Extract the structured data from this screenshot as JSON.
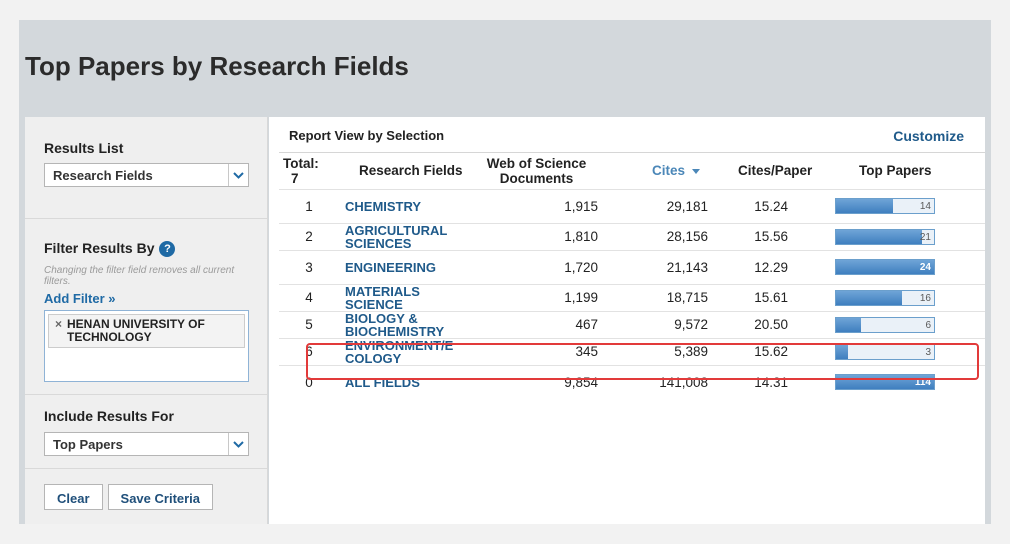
{
  "page_title": "Top Papers by Research Fields",
  "sidebar": {
    "results_list": {
      "title": "Results List",
      "selected": "Research Fields"
    },
    "filter": {
      "title": "Filter Results By",
      "hint": "Changing the filter field removes all current filters.",
      "add_filter": "Add Filter »",
      "chips": [
        "HENAN UNIVERSITY OF TECHNOLOGY"
      ]
    },
    "include": {
      "title": "Include Results For",
      "selected": "Top Papers"
    },
    "buttons": {
      "clear": "Clear",
      "save": "Save Criteria"
    }
  },
  "report": {
    "title": "Report View by Selection",
    "customize": "Customize",
    "headers": {
      "total": "Total:",
      "total_count": "7",
      "field": "Research Fields",
      "wos": "Web of Science Documents",
      "cites": "Cites",
      "cites_per_paper": "Cites/Paper",
      "top_papers": "Top Papers"
    },
    "rows": [
      {
        "rank": "1",
        "field": "CHEMISTRY",
        "wos": "1,915",
        "cites": "29,181",
        "cpp": "15.24",
        "top": "14",
        "fraction": 0.58
      },
      {
        "rank": "2",
        "field": "AGRICULTURAL SCIENCES",
        "wos": "1,810",
        "cites": "28,156",
        "cpp": "15.56",
        "top": "21",
        "fraction": 0.88
      },
      {
        "rank": "3",
        "field": "ENGINEERING",
        "wos": "1,720",
        "cites": "21,143",
        "cpp": "12.29",
        "top": "24",
        "fraction": 1.0
      },
      {
        "rank": "4",
        "field": "MATERIALS SCIENCE",
        "wos": "1,199",
        "cites": "18,715",
        "cpp": "15.61",
        "top": "16",
        "fraction": 0.67
      },
      {
        "rank": "5",
        "field": "BIOLOGY & BIOCHEMISTRY",
        "wos": "467",
        "cites": "9,572",
        "cpp": "20.50",
        "top": "6",
        "fraction": 0.25
      },
      {
        "rank": "6",
        "field": "ENVIRONMENT/E COLOGY",
        "wos": "345",
        "cites": "5,389",
        "cpp": "15.62",
        "top": "3",
        "fraction": 0.12
      },
      {
        "rank": "0",
        "field": "ALL FIELDS",
        "wos": "9,854",
        "cites": "141,008",
        "cpp": "14.31",
        "top": "114",
        "fraction": 1.0
      }
    ]
  },
  "colors": {
    "link": "#1f5a8a",
    "bar": "#4a88c6",
    "highlight": "#e23a3a"
  }
}
